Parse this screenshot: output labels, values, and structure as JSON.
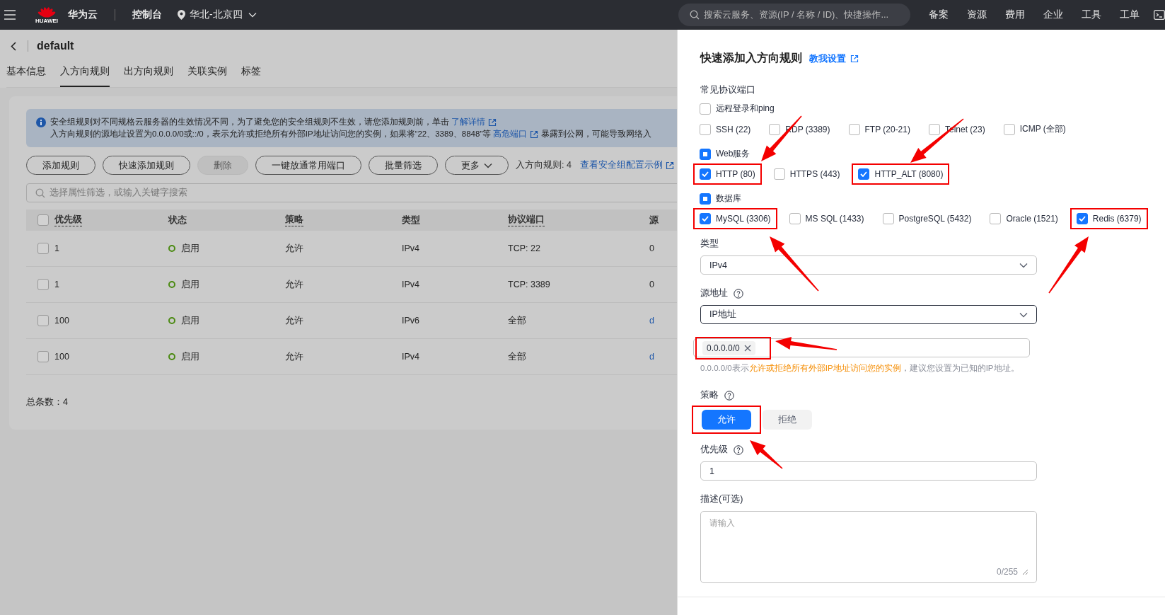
{
  "topbar": {
    "logo_text": "HUAWEI",
    "brand": "华为云",
    "console": "控制台",
    "region": "华北-北京四",
    "search_placeholder": "搜索云服务、资源(IP / 名称 / ID)、快捷操作...",
    "nav": [
      "备案",
      "资源",
      "费用",
      "企业",
      "工具",
      "工单"
    ]
  },
  "page": {
    "title": "default",
    "tabs": [
      {
        "label": "基本信息",
        "selected": false
      },
      {
        "label": "入方向规则",
        "selected": true
      },
      {
        "label": "出方向规则",
        "selected": false
      },
      {
        "label": "关联实例",
        "selected": false
      },
      {
        "label": "标签",
        "selected": false
      }
    ],
    "notice": {
      "line1": "安全组规则对不同规格云服务器的生效情况不同，为了避免您的安全组规则不生效，请您添加规则前，单击",
      "link1": "了解详情",
      "line2": "入方向规则的源地址设置为0.0.0.0/0或::/0，表示允许或拒绝所有外部IP地址访问您的实例，如果将“22、3389、8848”等",
      "link2": "高危端口",
      "line2_end": "暴露到公网，可能导致网络入"
    },
    "toolbar": [
      {
        "label": "添加规则",
        "disabled": false,
        "kind": "button"
      },
      {
        "label": "快速添加规则",
        "disabled": false,
        "kind": "button"
      },
      {
        "label": "删除",
        "disabled": true,
        "kind": "button"
      },
      {
        "label": "一键放通常用端口",
        "disabled": false,
        "kind": "button"
      },
      {
        "label": "批量筛选",
        "disabled": false,
        "kind": "button"
      },
      {
        "label": "更多",
        "disabled": false,
        "kind": "dropdown"
      }
    ],
    "rule_count": "入方向规则: 4",
    "example_link": "查看安全组配置示例",
    "search_placeholder": "选择属性筛选，或输入关键字搜索",
    "table": {
      "select_all_checked": false,
      "columns": [
        {
          "label": "优先级",
          "dashed": true
        },
        {
          "label": "状态",
          "dashed": false
        },
        {
          "label": "策略",
          "dashed": true
        },
        {
          "label": "类型",
          "dashed": false
        },
        {
          "label": "协议端口",
          "dashed": true
        },
        {
          "label": "源",
          "dashed": false
        }
      ],
      "rows": [
        {
          "checked": false,
          "priority": "1",
          "status": "启用",
          "policy": "允许",
          "type": "IPv4",
          "port": "TCP: 22",
          "source": "0",
          "source_link": false
        },
        {
          "checked": false,
          "priority": "1",
          "status": "启用",
          "policy": "允许",
          "type": "IPv4",
          "port": "TCP: 3389",
          "source": "0",
          "source_link": false
        },
        {
          "checked": false,
          "priority": "100",
          "status": "启用",
          "policy": "允许",
          "type": "IPv6",
          "port": "全部",
          "source": "d",
          "source_link": true
        },
        {
          "checked": false,
          "priority": "100",
          "status": "启用",
          "policy": "允许",
          "type": "IPv4",
          "port": "全部",
          "source": "d",
          "source_link": true
        }
      ]
    },
    "total": "总条数：4"
  },
  "drawer": {
    "title": "快速添加入方向规则",
    "help_link": "教我设置",
    "section": "常见协议端口",
    "groups": [
      {
        "label": "远程登录和ping",
        "partial": false,
        "options": [
          {
            "label": "SSH (22)",
            "checked": false,
            "highlighted": false
          },
          {
            "label": "RDP (3389)",
            "checked": false,
            "highlighted": false
          },
          {
            "label": "FTP (20-21)",
            "checked": false,
            "highlighted": false
          },
          {
            "label": "Telnet (23)",
            "checked": false,
            "highlighted": false
          },
          {
            "label": "ICMP (全部)",
            "checked": false,
            "highlighted": false
          }
        ]
      },
      {
        "label": "Web服务",
        "partial": true,
        "options": [
          {
            "label": "HTTP (80)",
            "checked": true,
            "highlighted": true
          },
          {
            "label": "HTTPS (443)",
            "checked": false,
            "highlighted": false
          },
          {
            "label": "HTTP_ALT (8080)",
            "checked": true,
            "highlighted": true
          }
        ]
      },
      {
        "label": "数据库",
        "partial": true,
        "options": [
          {
            "label": "MySQL (3306)",
            "checked": true,
            "highlighted": true
          },
          {
            "label": "MS SQL (1433)",
            "checked": false,
            "highlighted": false
          },
          {
            "label": "PostgreSQL (5432)",
            "checked": false,
            "highlighted": false
          },
          {
            "label": "Oracle (1521)",
            "checked": false,
            "highlighted": false
          },
          {
            "label": "Redis (6379)",
            "checked": true,
            "highlighted": true
          }
        ]
      }
    ],
    "type": {
      "label": "类型",
      "value": "IPv4"
    },
    "source": {
      "label": "源地址",
      "value": "IP地址",
      "tags": [
        {
          "text": "0.0.0.0/0",
          "highlighted": true
        }
      ],
      "hint": [
        {
          "text": "0.0.0.0/0表示",
          "warn": false
        },
        {
          "text": "允许或拒绝所有外部IP地址访问您的实例",
          "warn": true
        },
        {
          "text": "，建议您设置为已知的IP地址。",
          "warn": false
        }
      ]
    },
    "policy": {
      "label": "策略",
      "options": [
        {
          "label": "允许",
          "selected": true,
          "highlighted": true
        },
        {
          "label": "拒绝",
          "selected": false,
          "highlighted": false
        }
      ]
    },
    "priority": {
      "label": "优先级",
      "value": "1"
    },
    "description": {
      "label": "描述(可选)",
      "placeholder": "请输入",
      "counter": "0/255"
    }
  }
}
